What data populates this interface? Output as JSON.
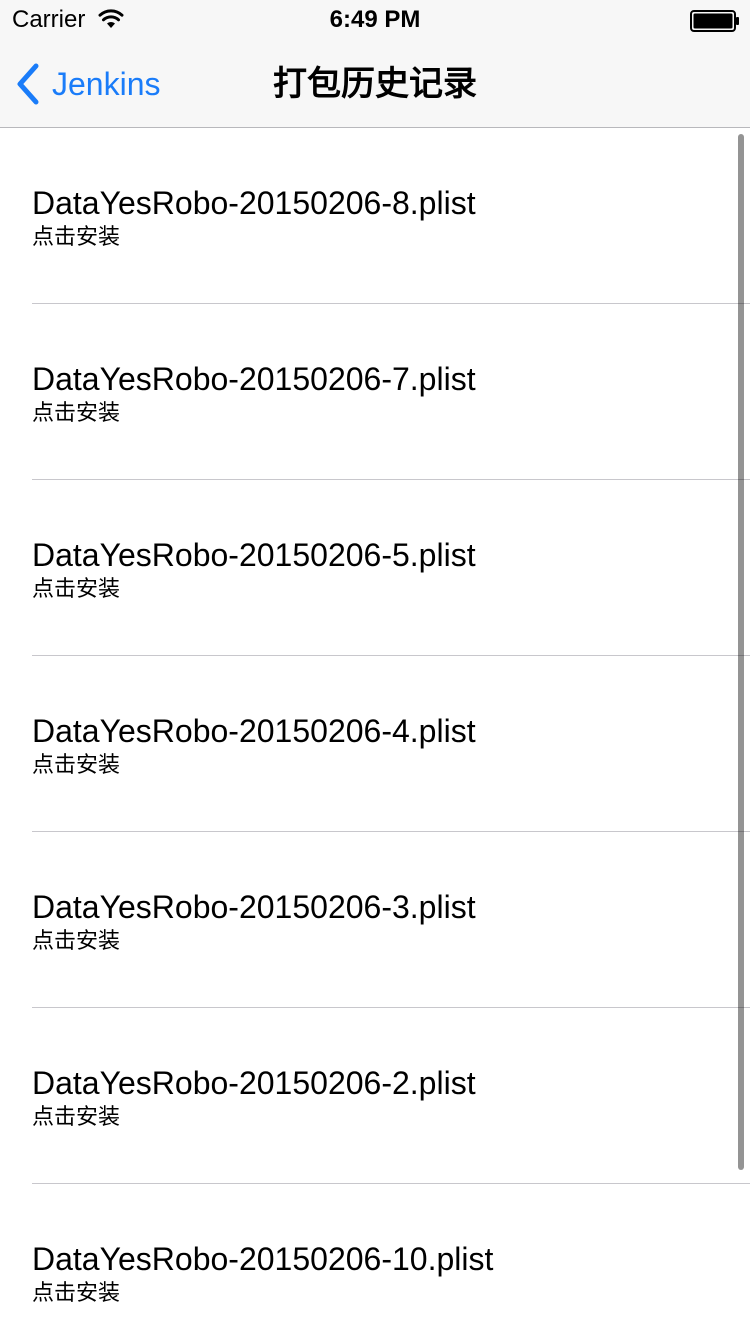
{
  "status_bar": {
    "carrier": "Carrier",
    "time": "6:49 PM",
    "wifi_icon": "wifi-icon",
    "battery_icon": "battery-icon"
  },
  "nav": {
    "back_label": "Jenkins",
    "title": "打包历史记录",
    "accent_color": "#1a7cf9"
  },
  "builds": [
    {
      "title": "DataYesRobo-20150206-8.plist",
      "subtitle": "点击安装"
    },
    {
      "title": "DataYesRobo-20150206-7.plist",
      "subtitle": "点击安装"
    },
    {
      "title": "DataYesRobo-20150206-5.plist",
      "subtitle": "点击安装"
    },
    {
      "title": "DataYesRobo-20150206-4.plist",
      "subtitle": "点击安装"
    },
    {
      "title": "DataYesRobo-20150206-3.plist",
      "subtitle": "点击安装"
    },
    {
      "title": "DataYesRobo-20150206-2.plist",
      "subtitle": "点击安装"
    },
    {
      "title": "DataYesRobo-20150206-10.plist",
      "subtitle": "点击安装"
    }
  ]
}
